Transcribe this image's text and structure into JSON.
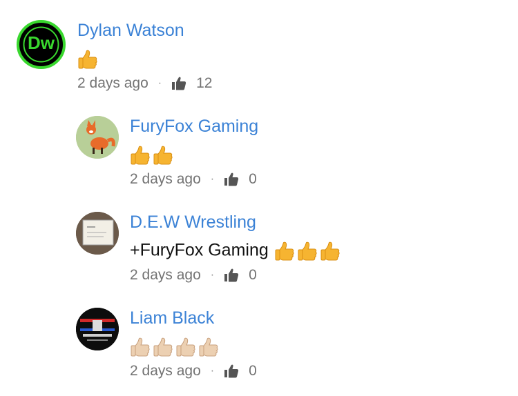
{
  "comments": [
    {
      "author": "Dylan Watson",
      "avatar": "logo-avatar",
      "avatar_initials": "Dw",
      "text": "",
      "emoji_count": 1,
      "emoji_tone": "yellow",
      "timestamp": "2 days ago",
      "likes": "12"
    },
    {
      "author": "FuryFox Gaming",
      "avatar": "fox-avatar",
      "text": "",
      "emoji_count": 2,
      "emoji_tone": "yellow",
      "timestamp": "2 days ago",
      "likes": "0"
    },
    {
      "author": "D.E.W Wrestling",
      "avatar": "sign-avatar",
      "text": "+FuryFox Gaming",
      "emoji_count": 3,
      "emoji_tone": "yellow",
      "timestamp": "2 days ago",
      "likes": "0"
    },
    {
      "author": "Liam Black",
      "avatar": "poster-avatar",
      "text": "",
      "emoji_count": 4,
      "emoji_tone": "light",
      "timestamp": "2 days ago",
      "likes": "0"
    }
  ],
  "separator": "·",
  "colors": {
    "author": "#3b82d6",
    "meta": "#737373",
    "logo_green": "#39d82e",
    "thumb_yellow": "#f6b431",
    "thumb_light": "#e8c8a8"
  }
}
